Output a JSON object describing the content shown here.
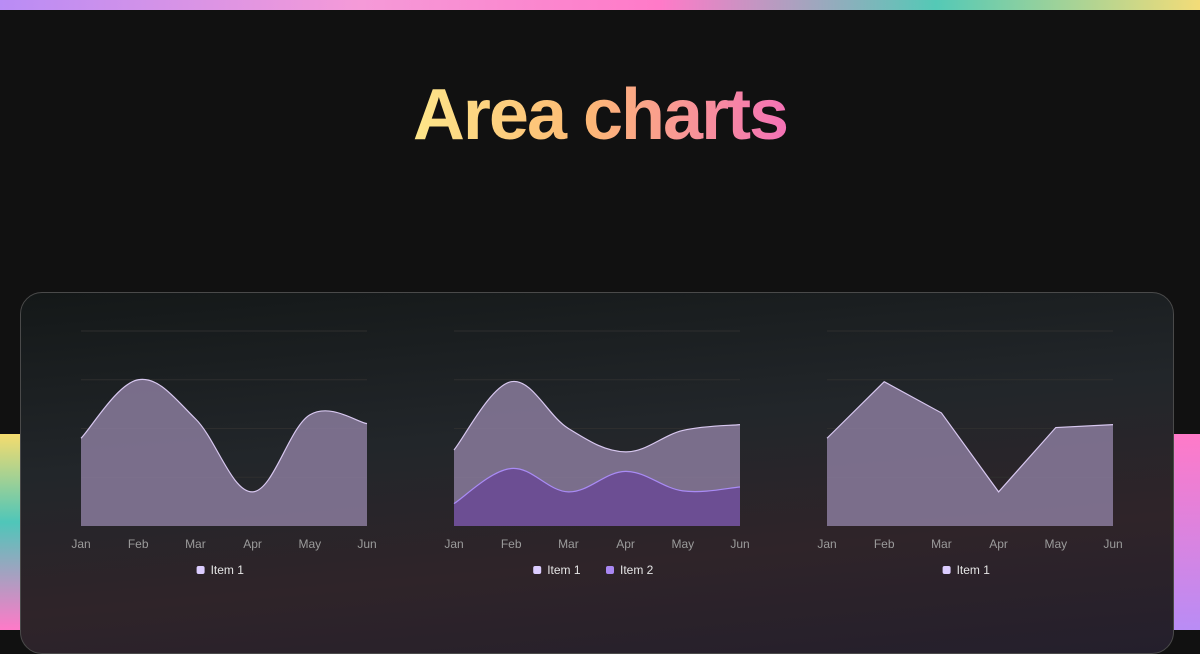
{
  "title": "Area charts",
  "colors": {
    "item1_fill": "#8a7b9c",
    "item1_stroke": "#d8c8f0",
    "item2_fill": "#6a4a94",
    "item2_stroke": "#a98bf5",
    "legend_item1": "#dccdff",
    "legend_item2": "#a987f2",
    "grid": "#2e2e2e"
  },
  "chart_data": [
    {
      "type": "area",
      "curve": "smooth",
      "categories": [
        "Jan",
        "Feb",
        "Mar",
        "Apr",
        "May",
        "Jun"
      ],
      "ylim": [
        0,
        200
      ],
      "grid": true,
      "legend_position": "bottom-center",
      "series": [
        {
          "name": "Item 1",
          "values": [
            90,
            150,
            110,
            35,
            114,
            105
          ]
        }
      ]
    },
    {
      "type": "area",
      "curve": "smooth",
      "categories": [
        "Jan",
        "Feb",
        "Mar",
        "Apr",
        "May",
        "Jun"
      ],
      "ylim": [
        0,
        200
      ],
      "grid": true,
      "legend_position": "bottom-center",
      "series": [
        {
          "name": "Item 1",
          "values": [
            78,
            148,
            100,
            76,
            98,
            104
          ]
        },
        {
          "name": "Item 2",
          "values": [
            23,
            59,
            35,
            56,
            36,
            40
          ]
        }
      ]
    },
    {
      "type": "area",
      "curve": "linear",
      "categories": [
        "Jan",
        "Feb",
        "Mar",
        "Apr",
        "May",
        "Jun"
      ],
      "ylim": [
        0,
        200
      ],
      "grid": true,
      "legend_position": "bottom-center",
      "series": [
        {
          "name": "Item 1",
          "values": [
            90,
            148,
            116,
            35,
            101,
            104
          ]
        }
      ]
    }
  ]
}
